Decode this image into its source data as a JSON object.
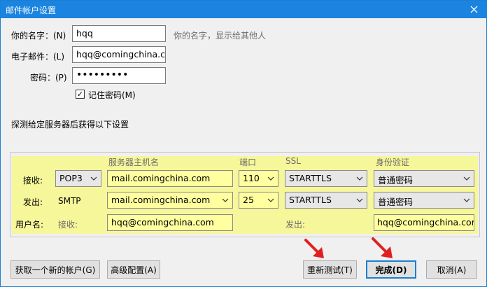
{
  "window": {
    "title": "邮件帐户设置",
    "close_glyph": "✕"
  },
  "account": {
    "name_label": "你的名字：(N)",
    "name_value": "hqq",
    "name_hint": "你的名字，显示给其他人",
    "email_label": "电子邮件：(L)",
    "email_value": "hqq@comingchina.com",
    "password_label": "密码：(P)",
    "password_value": "•••••••••",
    "remember_label": "记住密码(M)",
    "remember_checked": "✓"
  },
  "probe_text": "探测给定服务器后获得以下设置",
  "server": {
    "headers": {
      "hostname": "服务器主机名",
      "port": "端口",
      "ssl": "SSL",
      "auth": "身份验证"
    },
    "incoming": {
      "label": "接收:",
      "protocol": "POP3",
      "host": "mail.comingchina.com",
      "port": "110",
      "ssl": "STARTTLS",
      "auth": "普通密码"
    },
    "outgoing": {
      "label": "发出:",
      "protocol": "SMTP",
      "host": "mail.comingchina.com",
      "port": "25",
      "ssl": "STARTTLS",
      "auth": "普通密码"
    },
    "username": {
      "label": "用户名:",
      "incoming_label": "接收:",
      "incoming_value": "hqq@comingchina.com",
      "outgoing_label": "发出:",
      "outgoing_value": "hqq@comingchina.com"
    }
  },
  "buttons": {
    "new_account": "获取一个新的帐户(G)",
    "advanced": "高级配置(A)",
    "retest": "重新测试(T)",
    "done": "完成(D)",
    "cancel": "取消(A)"
  },
  "colors": {
    "titlebar": "#1a84e0",
    "highlight": "#f6f69a",
    "arrow": "#e02020"
  }
}
